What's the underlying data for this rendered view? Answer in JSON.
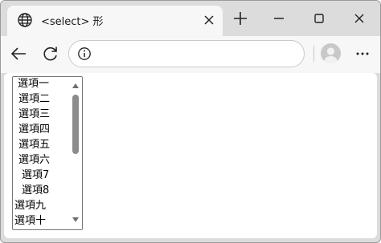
{
  "browser": {
    "tab_title": "<select> 形",
    "address_value": "",
    "icons": {
      "favicon": "globe-icon",
      "tab_close": "close-icon",
      "new_tab": "plus-icon",
      "minimize": "minimize-icon",
      "maximize": "maximize-icon",
      "close_window": "close-icon",
      "back": "back-arrow-icon",
      "refresh": "refresh-icon",
      "info": "info-icon",
      "profile": "profile-avatar-icon",
      "more": "more-dots-icon"
    }
  },
  "page": {
    "select_options": [
      "選項一",
      "選項二",
      "選項三",
      "選項四",
      "選項五",
      "選項六",
      "選項7",
      "選項8",
      "選項九",
      "選項十"
    ]
  },
  "colors": {
    "frame": "#dcdcdc",
    "toolbar": "#f7f7f7",
    "scrollbar_thumb": "#8c8c8c",
    "listbox_border": "#767676"
  }
}
